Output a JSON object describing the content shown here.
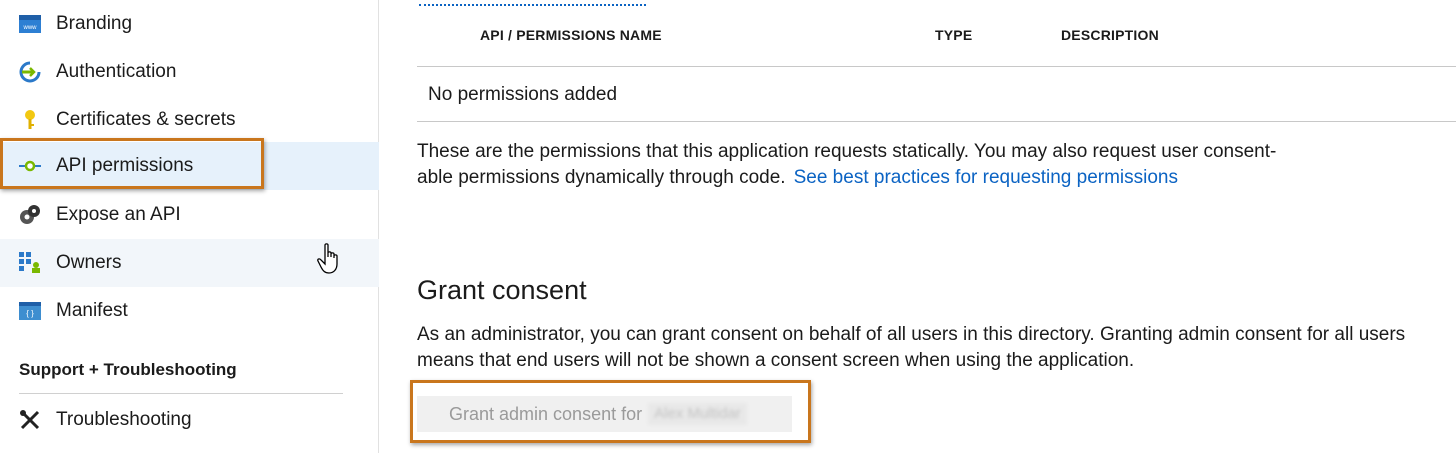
{
  "sidebar": {
    "items": [
      {
        "label": "Branding",
        "icon": "branding-icon"
      },
      {
        "label": "Authentication",
        "icon": "authentication-icon"
      },
      {
        "label": "Certificates & secrets",
        "icon": "key-icon"
      },
      {
        "label": "API permissions",
        "icon": "api-permissions-icon",
        "state": "selected"
      },
      {
        "label": "Expose an API",
        "icon": "expose-api-icon"
      },
      {
        "label": "Owners",
        "icon": "owners-icon",
        "state": "hover"
      },
      {
        "label": "Manifest",
        "icon": "manifest-icon"
      }
    ],
    "section_header": "Support + Troubleshooting",
    "support_items": [
      {
        "label": "Troubleshooting",
        "icon": "tools-icon"
      }
    ]
  },
  "permissions_table": {
    "headers": [
      "API / PERMISSIONS NAME",
      "TYPE",
      "DESCRIPTION"
    ],
    "empty_message": "No permissions added"
  },
  "info": {
    "text": "These are the permissions that this application requests statically. You may also request user consent-able permissions dynamically through code.",
    "link_text": "See best practices for requesting permissions"
  },
  "grant_consent": {
    "title": "Grant consent",
    "description": "As an administrator, you can grant consent on behalf of all users in this directory. Granting admin consent for all users means that end users will not be shown a consent screen when using the application.",
    "button_label": "Grant admin consent for",
    "tenant_name": "Alex Multidar"
  },
  "colors": {
    "accent": "#0b63c3",
    "highlight_border": "#c9761d",
    "selected_bg": "#e6f1fb"
  }
}
